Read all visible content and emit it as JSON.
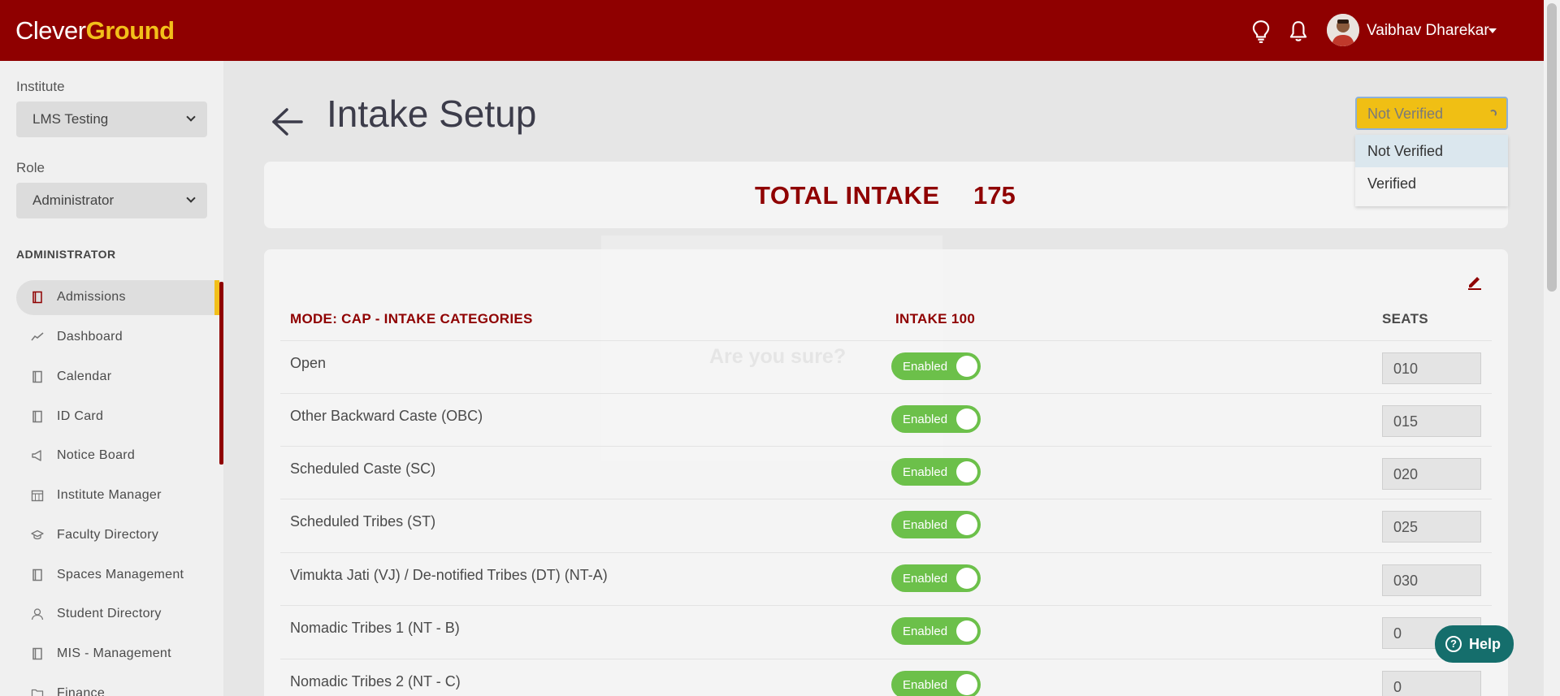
{
  "brand": {
    "part1": "Clever",
    "part2": "Ground"
  },
  "header": {
    "user_name": "Vaibhav Dharekar"
  },
  "sidebar": {
    "institute_label": "Institute",
    "institute_value": "LMS Testing",
    "role_label": "Role",
    "role_value": "Administrator",
    "section_heading": "ADMINISTRATOR",
    "items": [
      {
        "label": "Admissions",
        "icon": "book-icon"
      },
      {
        "label": "Dashboard",
        "icon": "chart-line-icon"
      },
      {
        "label": "Calendar",
        "icon": "book-icon"
      },
      {
        "label": "ID Card",
        "icon": "book-icon"
      },
      {
        "label": "Notice Board",
        "icon": "megaphone-icon"
      },
      {
        "label": "Institute Manager",
        "icon": "calendar-grid-icon"
      },
      {
        "label": "Faculty Directory",
        "icon": "graduation-cap-icon"
      },
      {
        "label": "Spaces Management",
        "icon": "book-icon"
      },
      {
        "label": "Student Directory",
        "icon": "user-icon"
      },
      {
        "label": "MIS - Management",
        "icon": "book-icon"
      },
      {
        "label": "Finance",
        "icon": "folder-icon"
      }
    ]
  },
  "page": {
    "title": "Intake Setup",
    "status_selected": "Not Verified",
    "status_options": [
      "Not Verified",
      "Verified"
    ],
    "total_label": "TOTAL INTAKE",
    "total_value": "175"
  },
  "table": {
    "col_category": "MODE: CAP - INTAKE CATEGORIES",
    "col_intake": "INTAKE 100",
    "col_seats": "SEATS",
    "rows": [
      {
        "category": "Open",
        "status": "Enabled",
        "seats": "010"
      },
      {
        "category": "Other Backward Caste (OBC)",
        "status": "Enabled",
        "seats": "015"
      },
      {
        "category": "Scheduled Caste (SC)",
        "status": "Enabled",
        "seats": "020"
      },
      {
        "category": "Scheduled Tribes (ST)",
        "status": "Enabled",
        "seats": "025"
      },
      {
        "category": "Vimukta Jati (VJ) / De-notified Tribes (DT) (NT-A)",
        "status": "Enabled",
        "seats": "030"
      },
      {
        "category": "Nomadic Tribes 1 (NT - B)",
        "status": "Enabled",
        "seats": "0"
      },
      {
        "category": "Nomadic Tribes 2 (NT - C)",
        "status": "Enabled",
        "seats": "0"
      }
    ]
  },
  "modal": {
    "title": "Are you sure?"
  },
  "help": {
    "label": "Help"
  },
  "colors": {
    "brand_red": "#8f0000",
    "brand_yellow": "#f2bf1a",
    "toggle_green": "#6cc04a",
    "help_teal": "#156e6c"
  }
}
